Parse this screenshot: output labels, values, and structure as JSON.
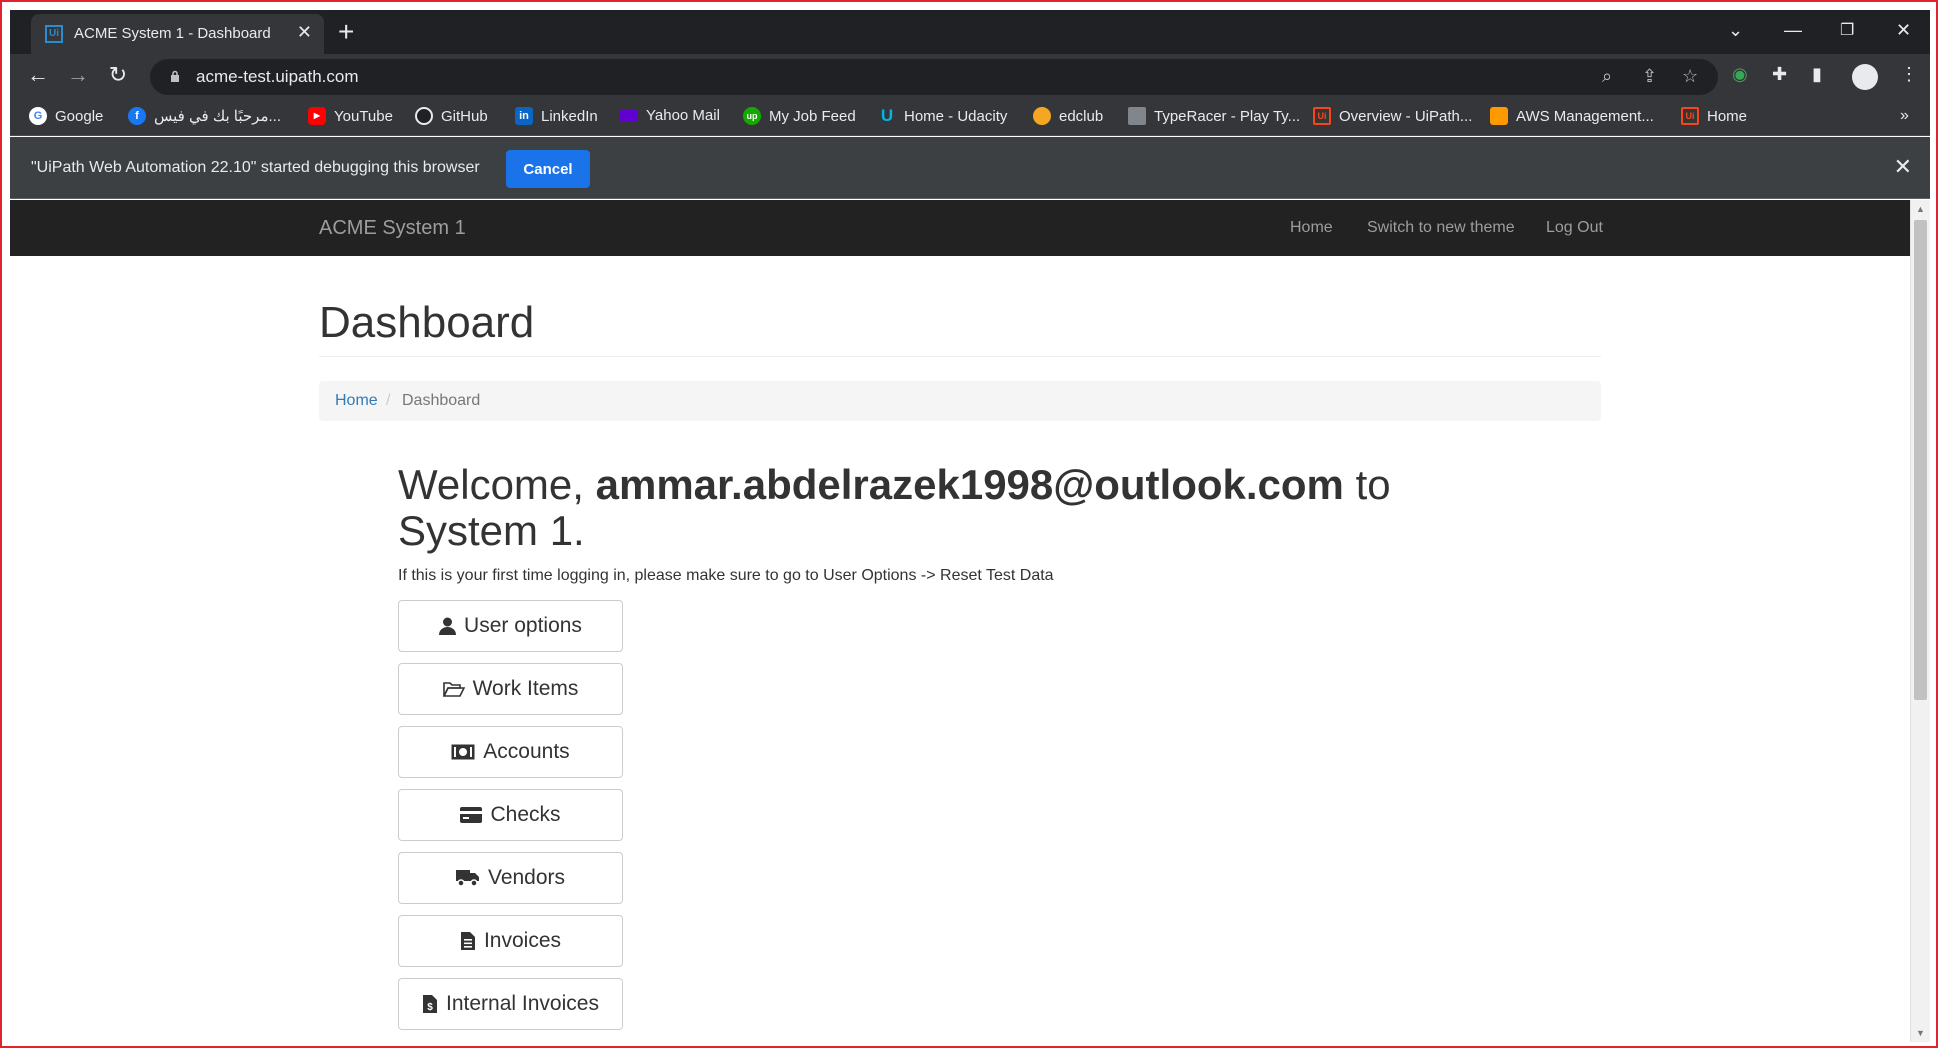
{
  "browser": {
    "tab_title": "ACME System 1 - Dashboard",
    "tab_favicon": "Ui",
    "url": "acme-test.uipath.com"
  },
  "bookmarks": [
    {
      "label": "Google",
      "icon": "google-icon",
      "color": "#4285f4"
    },
    {
      "label": "مرحبًا بك في فيس...",
      "icon": "facebook-icon",
      "color": "#1877f2"
    },
    {
      "label": "YouTube",
      "icon": "youtube-icon",
      "color": "#ff0000"
    },
    {
      "label": "GitHub",
      "icon": "github-icon",
      "color": "#e8eaed"
    },
    {
      "label": "LinkedIn",
      "icon": "linkedin-icon",
      "color": "#0a66c2"
    },
    {
      "label": "Yahoo Mail",
      "icon": "yahoo-mail-icon",
      "color": "#6001d2"
    },
    {
      "label": "My Job Feed",
      "icon": "upwork-icon",
      "color": "#14a800"
    },
    {
      "label": "Home - Udacity",
      "icon": "udacity-icon",
      "color": "#02b3e4"
    },
    {
      "label": "edclub",
      "icon": "edclub-icon",
      "color": "#f5a623"
    },
    {
      "label": "TypeRacer - Play Ty...",
      "icon": "typeracer-icon",
      "color": "#bdc1c6"
    },
    {
      "label": "Overview - UiPath...",
      "icon": "uipath-icon",
      "color": "#fa4616"
    },
    {
      "label": "AWS Management...",
      "icon": "aws-icon",
      "color": "#ff9900"
    },
    {
      "label": "Home",
      "icon": "uipath-icon",
      "color": "#fa4616"
    }
  ],
  "debug_bar": {
    "message": "\"UiPath Web Automation 22.10\" started debugging this browser",
    "cancel_label": "Cancel"
  },
  "navbar": {
    "brand": "ACME System 1",
    "links": [
      "Home",
      "Switch to new theme",
      "Log Out"
    ]
  },
  "page": {
    "title": "Dashboard",
    "breadcrumb": {
      "home": "Home",
      "separator": "/",
      "current": "Dashboard"
    },
    "welcome_prefix": "Welcome, ",
    "welcome_user": "ammar.abdelrazek1998@outlook.com",
    "welcome_suffix": " to System 1.",
    "first_time_note": "If this is your first time logging in, please make sure to go to User Options -> Reset Test Data",
    "menu": [
      {
        "label": "User options",
        "icon": "user-icon"
      },
      {
        "label": "Work Items",
        "icon": "folder-open-icon"
      },
      {
        "label": "Accounts",
        "icon": "money-icon"
      },
      {
        "label": "Checks",
        "icon": "credit-card-icon"
      },
      {
        "label": "Vendors",
        "icon": "truck-icon"
      },
      {
        "label": "Invoices",
        "icon": "file-text-icon"
      },
      {
        "label": "Internal Invoices",
        "icon": "file-invoice-icon"
      }
    ]
  }
}
